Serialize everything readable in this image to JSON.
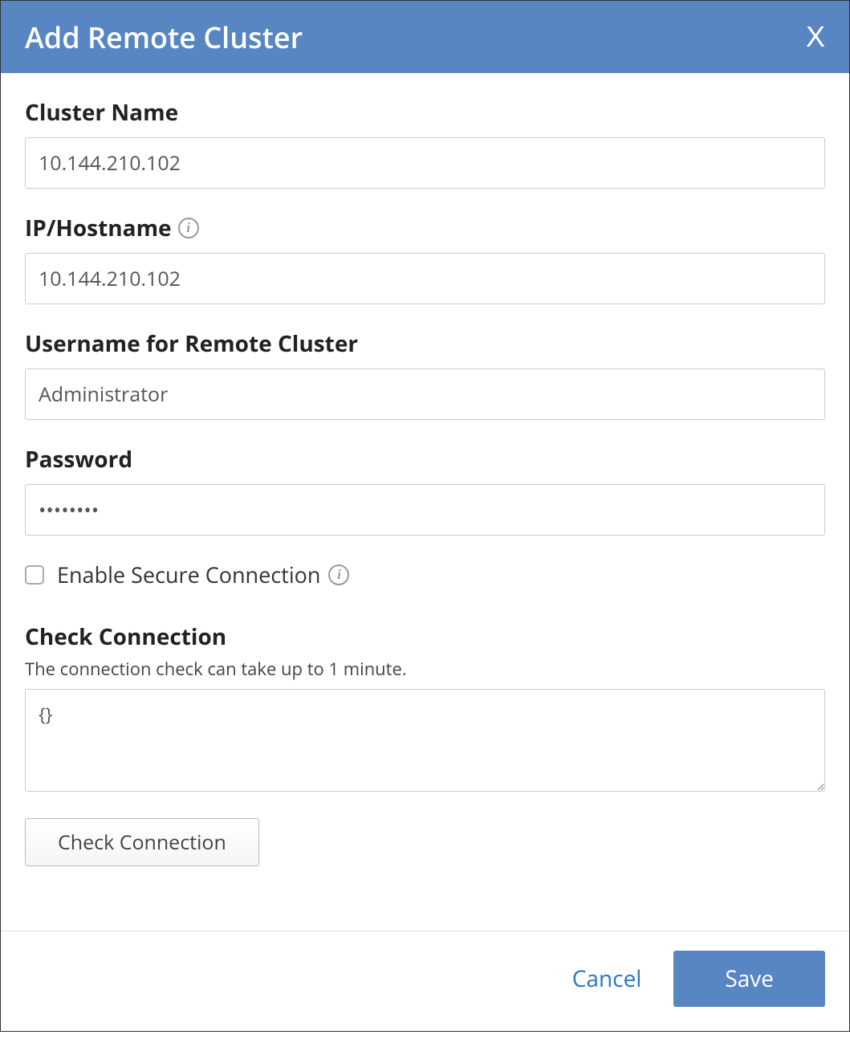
{
  "header": {
    "title": "Add Remote Cluster",
    "close_label": "X"
  },
  "form": {
    "cluster_name": {
      "label": "Cluster Name",
      "value": "10.144.210.102"
    },
    "ip_hostname": {
      "label": "IP/Hostname",
      "value": "10.144.210.102"
    },
    "username": {
      "label": "Username for Remote Cluster",
      "value": "Administrator"
    },
    "password": {
      "label": "Password",
      "value": "••••••••"
    },
    "secure_connection": {
      "label": "Enable Secure Connection",
      "checked": false
    },
    "check_connection": {
      "title": "Check Connection",
      "helper": "The connection check can take up to 1 minute.",
      "value": "{}",
      "button": "Check Connection"
    }
  },
  "footer": {
    "cancel": "Cancel",
    "save": "Save"
  }
}
